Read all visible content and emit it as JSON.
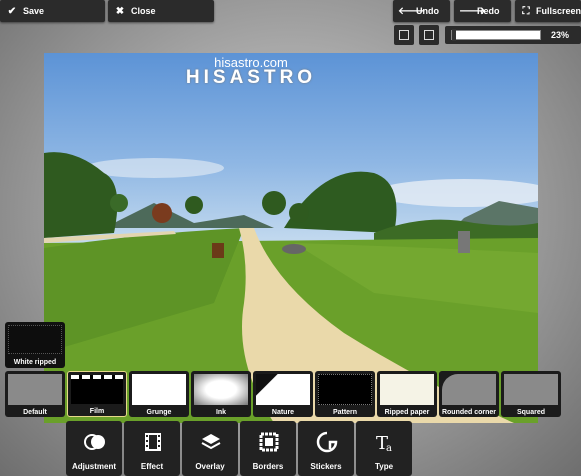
{
  "toolbar": {
    "save_label": "Save",
    "close_label": "Close",
    "undo_label": "Undo",
    "redo_label": "Redo",
    "fullscreen_label": "Fullscreen",
    "zoom_value": "23%"
  },
  "watermark": {
    "url": "hisastro.com",
    "logo": "HISASTRO"
  },
  "border_presets": {
    "selected_label": "White ripped",
    "items": [
      "Default",
      "Film",
      "Grunge",
      "Ink",
      "Nature",
      "Pattern",
      "Ripped paper",
      "Rounded corner",
      "Squared"
    ]
  },
  "tools": [
    "Adjustment",
    "Effect",
    "Overlay",
    "Borders",
    "Stickers",
    "Type"
  ],
  "colors": {
    "accent": "#2b2b2b",
    "sky": "#7aa9e0",
    "grass": "#6b9e2a",
    "path": "#e8d7a8"
  }
}
